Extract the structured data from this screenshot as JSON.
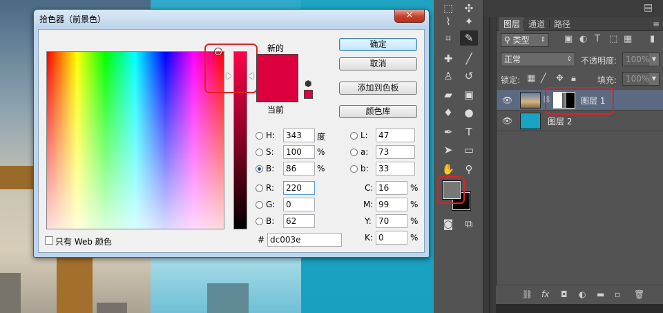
{
  "dialog": {
    "title": "拾色器（前景色）",
    "close_label": "✕",
    "new_label": "新的",
    "current_label": "当前",
    "buttons": {
      "ok": "确定",
      "cancel": "取消",
      "add_swatch": "添加到色板",
      "color_library": "颜色库"
    },
    "only_web_label": "只有 Web 颜色",
    "hsb": {
      "h": {
        "label": "H:",
        "value": "343",
        "unit": "度"
      },
      "s": {
        "label": "S:",
        "value": "100",
        "unit": "%"
      },
      "b": {
        "label": "B:",
        "value": "86",
        "unit": "%"
      }
    },
    "rgb": {
      "r": {
        "label": "R:",
        "value": "220"
      },
      "g": {
        "label": "G:",
        "value": "0"
      },
      "b": {
        "label": "B:",
        "value": "62"
      }
    },
    "lab": {
      "l": {
        "label": "L:",
        "value": "47"
      },
      "a": {
        "label": "a:",
        "value": "73"
      },
      "b": {
        "label": "b:",
        "value": "33"
      }
    },
    "cmyk": {
      "c": {
        "label": "C:",
        "value": "16",
        "unit": "%"
      },
      "m": {
        "label": "M:",
        "value": "99",
        "unit": "%"
      },
      "y": {
        "label": "Y:",
        "value": "70",
        "unit": "%"
      },
      "k": {
        "label": "K:",
        "value": "0",
        "unit": "%"
      }
    },
    "hex_label": "#",
    "hex_value": "dc003e",
    "selected_radio": "B",
    "colors": {
      "new": "#dc003e",
      "current": "#dc003e"
    }
  },
  "tools": {
    "icons": [
      "polygonal-lasso-icon",
      "magic-wand-icon",
      "crop-icon",
      "eyedropper-icon",
      "healing-brush-icon",
      "brush-icon",
      "clone-stamp-icon",
      "history-brush-icon",
      "eraser-icon",
      "gradient-icon",
      "blur-icon",
      "dodge-icon",
      "pen-icon",
      "type-icon",
      "path-selection-icon",
      "rectangle-icon",
      "hand-icon",
      "zoom-icon"
    ],
    "foreground": "#777777",
    "background": "#000000"
  },
  "layers_panel": {
    "tabs": [
      "图层",
      "通道",
      "路径"
    ],
    "filter_kind": "类型",
    "blend_mode": "正常",
    "opacity_label": "不透明度:",
    "opacity_value": "100%",
    "lock_label": "锁定:",
    "fill_label": "填充:",
    "fill_value": "100%",
    "layers": [
      {
        "name": "图层 1",
        "selected": true,
        "has_mask": true
      },
      {
        "name": "图层 2",
        "selected": false,
        "has_mask": false
      }
    ],
    "bottom_icons": [
      "link-icon",
      "fx-icon",
      "mask-icon",
      "adjustment-icon",
      "group-icon",
      "new-layer-icon",
      "trash-icon"
    ]
  }
}
